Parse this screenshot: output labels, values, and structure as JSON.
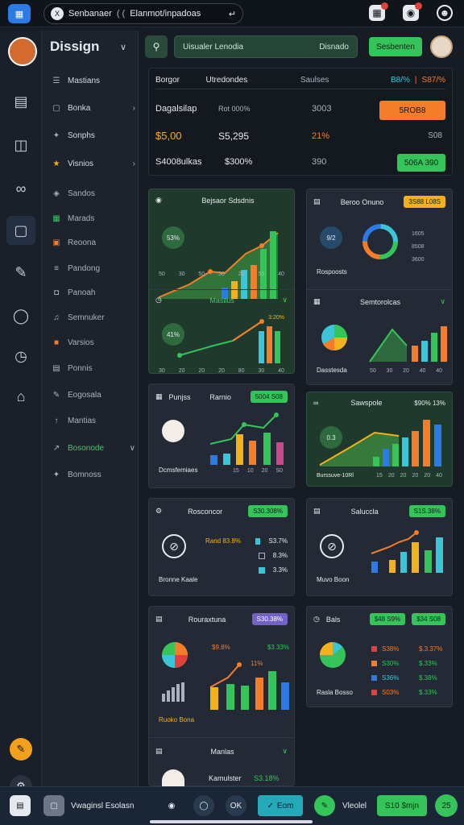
{
  "topbar": {
    "app_name": "Senbanaer",
    "url": "Elanmot/inpadoas",
    "url_prefix": "( (",
    "icons": [
      "grid-icon",
      "bell-icon",
      "chat-icon",
      "user-icon"
    ]
  },
  "sidebar": {
    "title": "Dissign",
    "items": [
      {
        "label": "Mastians",
        "icon": "list-icon"
      },
      {
        "label": "Bonka",
        "icon": "folder-icon",
        "chevron": true
      },
      {
        "label": "Sonphs",
        "icon": "link-icon"
      },
      {
        "label": "Visnios",
        "icon": "star-icon",
        "chevron": true
      },
      {
        "label": "Sandos",
        "icon": "layers-icon"
      },
      {
        "label": "Marads",
        "icon": "grid-icon"
      },
      {
        "label": "Reoona",
        "icon": "box-icon"
      },
      {
        "label": "Pandong",
        "icon": "chart-icon"
      },
      {
        "label": "Panoah",
        "icon": "bag-icon"
      },
      {
        "label": "Semnuker",
        "icon": "sound-icon"
      },
      {
        "label": "Varsios",
        "icon": "tag-icon"
      },
      {
        "label": "Ponnis",
        "icon": "doc-icon"
      },
      {
        "label": "Eogosala",
        "icon": "pen-icon"
      },
      {
        "label": "Mantias",
        "icon": "arrow-icon"
      },
      {
        "label": "Bosonode",
        "icon": "trend-icon",
        "chevron": true
      },
      {
        "label": "Bomnoss",
        "icon": "link-icon"
      }
    ]
  },
  "toolbar": {
    "field_left": "Uisualer Lenodia",
    "field_right": "Disnado",
    "button": "Sesbenten"
  },
  "summary": {
    "head": [
      "Borgor",
      "Utredondes",
      "Saulses",
      "B8/%",
      "|",
      "S87/%"
    ],
    "rows": [
      {
        "a": "Dagalsilap",
        "b": "Rot 000%",
        "c": "3003",
        "btn": "5ROB8"
      },
      {
        "a": "$5,00",
        "b": "S5,295",
        "c": "21%",
        "d": "S08"
      },
      {
        "a": "S4008ulkas",
        "b": "$300%",
        "c": "390",
        "btn": "506A 390"
      }
    ]
  },
  "cards": {
    "c1": {
      "title": "Bejsaor Sdsdnis",
      "kpi": "53%",
      "axis": [
        "50",
        "30",
        "50",
        "30",
        "20",
        "50",
        "40"
      ]
    },
    "c1b": {
      "title": "Masilus",
      "kpi": "41%",
      "tag": "3:20%",
      "axis": [
        "30",
        "20",
        "20",
        "20",
        "80",
        "30",
        "40"
      ]
    },
    "c2": {
      "title": "Beroo Onuno",
      "tag": "3S88 L08S",
      "kpi": "9/2",
      "caption": "Rospoosts",
      "side": [
        "1605",
        "8508",
        "3600"
      ]
    },
    "c2b": {
      "title": "Semtorolcas",
      "caption": "Dasstesda",
      "axis": [
        "50",
        "30",
        "20",
        "40",
        "40"
      ]
    },
    "c3": {
      "title": "Punjss",
      "label": "Rarnio",
      "tag": "5004 S08",
      "caption": "Dcmsfemiaes",
      "axis": [
        "15",
        "10",
        "20",
        "S0"
      ]
    },
    "c4": {
      "title": "Sawspole",
      "tag": "$90% 13%",
      "kpi": "0.3",
      "caption": "Burssuve-10Rl",
      "axis": [
        "15",
        "20",
        "20",
        "20",
        "20",
        "40"
      ]
    },
    "c5": {
      "title": "Rosconcor",
      "tag": "S30.308%",
      "caption": "Bronne Kaale",
      "rows": [
        [
          "Rand 83.8%",
          "S3.7%"
        ],
        [
          "",
          "8.3%"
        ],
        [
          "",
          "3.3%"
        ]
      ]
    },
    "c6": {
      "title": "Saluccla",
      "tag": "S1S.38%",
      "caption": "Muvo Boon"
    },
    "c7": {
      "title": "Rouraxtuna",
      "tag": "S30.38%",
      "caption": "Ruoko Bona",
      "pct": "11%",
      "r1": [
        "$9.8%",
        "$3.33%"
      ]
    },
    "c7b": {
      "title": "Manlas",
      "label": "Kamulster",
      "value": "S3.18%"
    },
    "c8": {
      "title": "Bals",
      "tag1": "$48 S9%",
      "tag2": "$34 S08",
      "caption": "Rasla Bosso",
      "rows": [
        [
          "S38%",
          "$.3.37%"
        ],
        [
          "S30%",
          "$.33%"
        ],
        [
          "S36%",
          "$.38%"
        ],
        [
          "S03%",
          "$.33%"
        ]
      ]
    }
  },
  "bottombar": {
    "label": "Vwaginsl Esolasn",
    "btn1": "Eom",
    "btn2": "Vleolel",
    "btn3": "S10 $mjn",
    "badge": "25"
  },
  "colors": {
    "green": "#35c45a",
    "orange": "#f47d2b",
    "blue": "#2c7be5",
    "yellow": "#f3b11c"
  }
}
